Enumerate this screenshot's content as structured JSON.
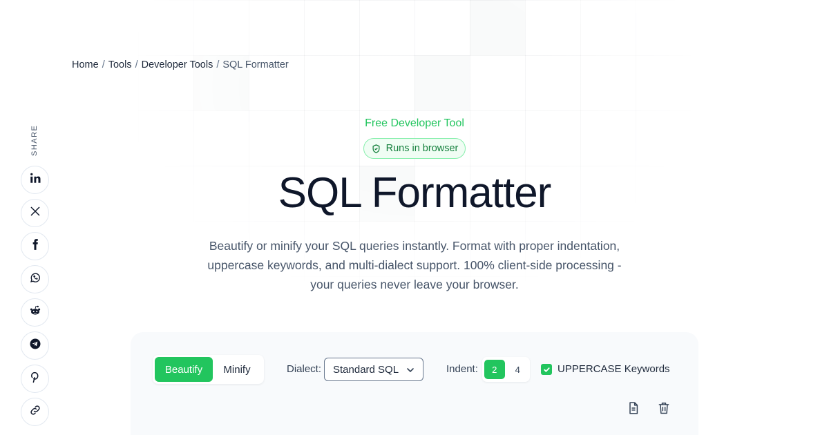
{
  "breadcrumb": {
    "items": [
      "Home",
      "Tools",
      "Developer Tools"
    ],
    "separator": "/",
    "current": "SQL Formatter"
  },
  "share": {
    "label": "SHARE",
    "buttons": [
      "linkedin-icon",
      "x-icon",
      "facebook-icon",
      "whatsapp-icon",
      "reddit-icon",
      "telegram-icon",
      "pinterest-icon",
      "link-icon"
    ]
  },
  "hero": {
    "eyebrow": "Free Developer Tool",
    "badge": "Runs in browser",
    "title": "SQL Formatter",
    "description": "Beautify or minify your SQL queries instantly. Format with proper indentation, uppercase keywords, and multi-dialect support. 100% client-side processing - your queries never leave your browser."
  },
  "tool": {
    "modes": [
      "Beautify",
      "Minify"
    ],
    "active_mode": "Beautify",
    "dialect_label": "Dialect:",
    "dialect_value": "Standard SQL",
    "indent_label": "Indent:",
    "indent_options": [
      "2",
      "4"
    ],
    "indent_selected": "2",
    "uppercase_label": "UPPERCASE Keywords",
    "uppercase_checked": true,
    "actions": [
      "document-icon",
      "trash-icon"
    ]
  },
  "colors": {
    "accent": "#22c55e",
    "text_dark": "#0f172a",
    "text_muted": "#475569",
    "panel_bg": "#f8fafc"
  }
}
